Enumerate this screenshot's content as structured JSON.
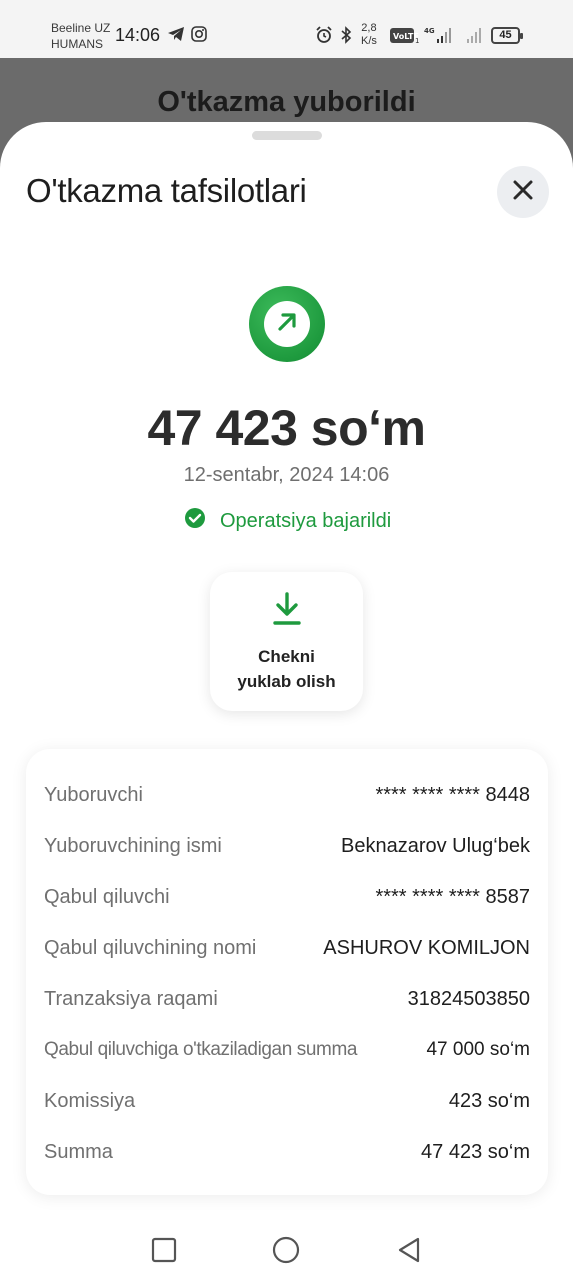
{
  "status_bar": {
    "carrier_line1": "Beeline UZ",
    "carrier_line2": "HUMANS",
    "time": "14:06",
    "speed_value": "2,8",
    "speed_unit": "K/s",
    "battery": "45",
    "icons": [
      "telegram-icon",
      "instagram-icon",
      "alarm-icon",
      "bluetooth-icon",
      "volte-icon",
      "signal-4g-icon",
      "signal-icon",
      "battery-icon"
    ]
  },
  "background_title": "O'tkazma yuborildi",
  "sheet": {
    "title": "O'tkazma tafsilotlari",
    "close_icon": "close-icon"
  },
  "transfer": {
    "amount": "47 423 so‘m",
    "datetime": "12-sentabr, 2024 14:06",
    "status_text": "Operatsiya bajarildi",
    "status_color": "#1e9a3e",
    "status_icon": "check-circle-icon",
    "direction_icon": "arrow-up-right-icon"
  },
  "download": {
    "line1": "Chekni",
    "line2": "yuklab olish",
    "icon": "download-icon"
  },
  "details": [
    {
      "label": "Yuboruvchi",
      "value": "**** **** **** 8448"
    },
    {
      "label": "Yuboruvchining ismi",
      "value": "Beknazarov Ulug‘bek"
    },
    {
      "label": "Qabul qiluvchi",
      "value": "**** **** **** 8587"
    },
    {
      "label": "Qabul qiluvchining nomi",
      "value": "ASHUROV KOMILJON"
    },
    {
      "label": "Tranzaksiya raqami",
      "value": "31824503850"
    },
    {
      "label": "Qabul qiluvchiga o'tkaziladigan summa",
      "value": "47 000 so‘m"
    },
    {
      "label": "Komissiya",
      "value": "423 so‘m"
    },
    {
      "label": "Summa",
      "value": "47 423 so‘m"
    }
  ],
  "colors": {
    "accent_green": "#1e9a3e",
    "overlay": "#6b6b6b"
  },
  "nav": [
    "recent-apps-icon",
    "home-icon",
    "back-icon"
  ]
}
